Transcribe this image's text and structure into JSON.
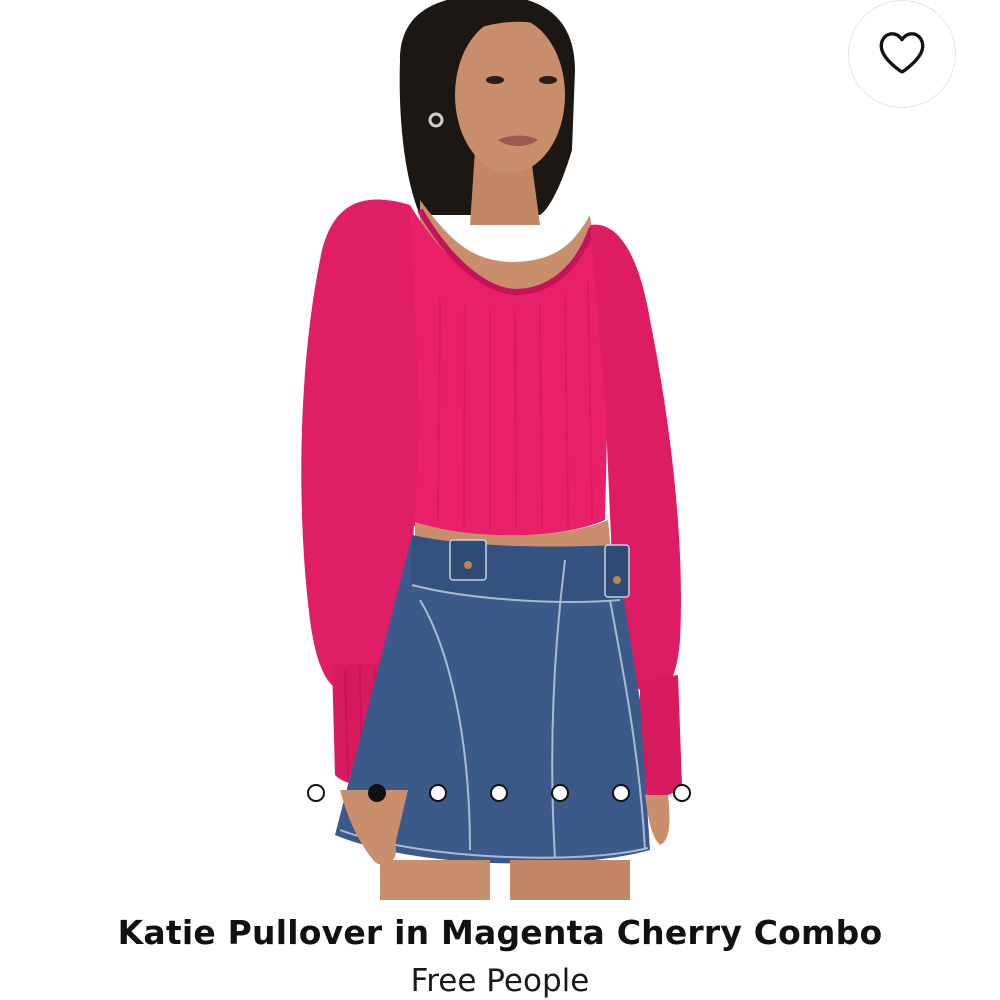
{
  "product": {
    "title": "Katie Pullover in Magenta Cherry Combo",
    "brand": "Free People"
  },
  "image": {
    "description_icon": "product-photo",
    "sweater_color": "#e8206a",
    "skirt_color": "#3b5a8a",
    "hair_color": "#1d1714",
    "skin_color": "#c98f6c"
  },
  "wishlist": {
    "icon": "heart-outline-icon"
  },
  "carousel": {
    "total": 7,
    "active_index": 1
  }
}
